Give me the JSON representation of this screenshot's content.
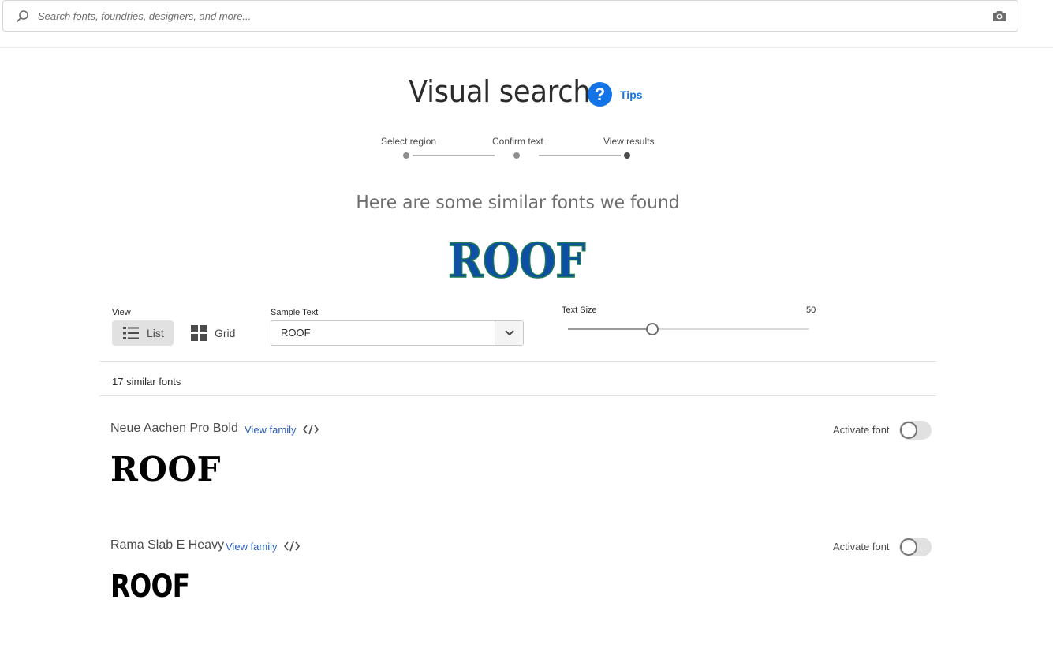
{
  "search": {
    "placeholder": "Search fonts, foundries, designers, and more...",
    "icon": "search-icon",
    "camera_icon": "camera-icon"
  },
  "header": {
    "title": "Visual search",
    "tips_label": "Tips"
  },
  "steps": [
    {
      "label": "Select region",
      "state": "done"
    },
    {
      "label": "Confirm text",
      "state": "done"
    },
    {
      "label": "View results",
      "state": "current"
    }
  ],
  "results_heading": "Here are some similar fonts we found",
  "sample_image_text": "ROOF",
  "controls": {
    "view_label": "View",
    "view_options": [
      {
        "label": "List",
        "icon": "list-icon",
        "selected": true
      },
      {
        "label": "Grid",
        "icon": "grid-icon",
        "selected": false
      }
    ],
    "sample_text_label": "Sample Text",
    "sample_text_value": "ROOF",
    "text_size_label": "Text Size",
    "text_size_value": "50",
    "text_size_fraction": 0.35
  },
  "results_count": "17 similar fonts",
  "fonts": [
    {
      "name": "Neue Aachen Pro Bold",
      "view_family": "View family",
      "activate_label": "Activate font",
      "activated": false,
      "preview": "ROOF"
    },
    {
      "name": "Rama Slab E Heavy",
      "view_family": "View family",
      "activate_label": "Activate font",
      "activated": false,
      "preview": "ROOF"
    }
  ],
  "colors": {
    "accent": "#1473e6",
    "link": "#2d5fbe",
    "sample_fill": "#0f4fa3",
    "sample_outline": "#1a7a52"
  }
}
